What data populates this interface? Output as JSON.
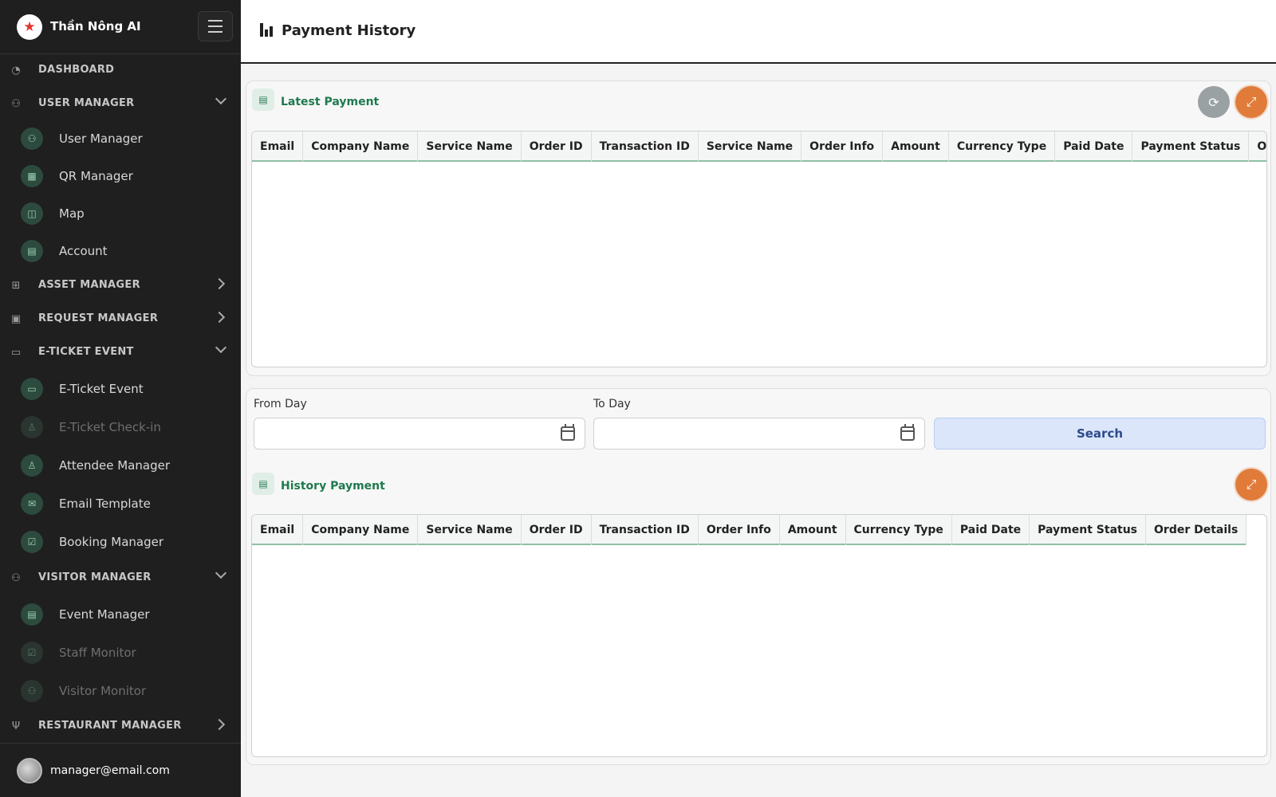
{
  "app": {
    "name": "Thần Nông AI"
  },
  "sidebar": {
    "dashboard": "DASHBOARD",
    "user_manager": "USER MANAGER",
    "user_items": [
      "User Manager",
      "QR Manager",
      "Map",
      "Account"
    ],
    "asset_manager": "ASSET MANAGER",
    "request_manager": "REQUEST MANAGER",
    "eticket": "E-TICKET EVENT",
    "eticket_items": [
      "E-Ticket Event",
      "E-Ticket Check-in",
      "Attendee Manager",
      "Email Template",
      "Booking Manager"
    ],
    "visitor_manager": "VISITOR MANAGER",
    "visitor_items": [
      "Event Manager",
      "Staff Monitor",
      "Visitor Monitor"
    ],
    "restaurant_manager": "RESTAURANT MANAGER"
  },
  "user": {
    "email": "manager@email.com"
  },
  "header": {
    "title": "Payment History"
  },
  "latest": {
    "title": "Latest Payment",
    "columns": [
      "Email",
      "Company Name",
      "Service Name",
      "Order ID",
      "Transaction ID",
      "Service Name",
      "Order Info",
      "Amount",
      "Currency Type",
      "Paid Date",
      "Payment Status",
      "Order Details"
    ]
  },
  "filter": {
    "from_label": "From Day",
    "to_label": "To Day",
    "from_value": "",
    "to_value": "",
    "search_label": "Search"
  },
  "history": {
    "title": "History Payment",
    "columns": [
      "Email",
      "Company Name",
      "Service Name",
      "Order ID",
      "Transaction ID",
      "Order Info",
      "Amount",
      "Currency Type",
      "Paid Date",
      "Payment Status",
      "Order Details"
    ]
  }
}
